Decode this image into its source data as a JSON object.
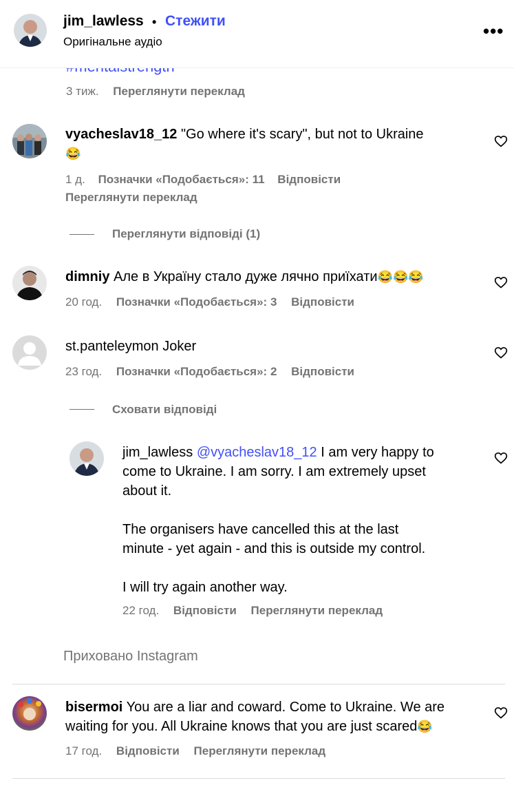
{
  "header": {
    "username": "jim_lawless",
    "separator": "•",
    "follow_label": "Стежити",
    "audio_label": "Оригінальне аудіо",
    "more_label": "•••"
  },
  "clipped_hashtag": "#mentalstrength",
  "caption_meta": {
    "time": "3 тиж.",
    "translate": "Переглянути переклад"
  },
  "comments": [
    {
      "username": "vyacheslav18_12",
      "text": "\"Go where it's scary\", but not to Ukraine",
      "emoji": "😂",
      "time": "1 д.",
      "likes": "Позначки «Подобається»: 11",
      "reply": "Відповісти",
      "translate": "Переглянути переклад",
      "replies_toggle": "Переглянути відповіді (1)"
    },
    {
      "username": "dimniy",
      "text": "Але в Україну стало дуже лячно приїхати",
      "emoji": "😂😂😂",
      "time": "20 год.",
      "likes": "Позначки «Подобається»: 3",
      "reply": "Відповісти"
    },
    {
      "username": "st.panteleymon",
      "text": "Joker",
      "time": "23 год.",
      "likes": "Позначки «Подобається»: 2",
      "reply": "Відповісти",
      "replies_toggle": "Сховати відповіді"
    }
  ],
  "reply": {
    "username": "jim_lawless",
    "mention": "@vyacheslav18_12",
    "line1": "I am very happy to",
    "line2": "come to Ukraine. I am sorry. I am extremely upset",
    "line3": "about it.",
    "line4": "The organisers have cancelled this at the last",
    "line5": "minute - yet again - and this is outside my control.",
    "line6": "I will try again another way.",
    "time": "22 год.",
    "reply_label": "Відповісти",
    "translate": "Переглянути переклад"
  },
  "hidden_label": "Приховано Instagram",
  "last_comment": {
    "username": "bisermoi",
    "line1": "You are a liar and coward. Come to Ukraine. We are",
    "line2": "waiting for you. All Ukraine knows that you are just scared",
    "emoji": "😂",
    "time": "17 год.",
    "reply": "Відповісти",
    "translate": "Переглянути переклад"
  },
  "colors": {
    "link": "#4150f7",
    "muted": "#737373",
    "divider": "#dbdbdb"
  }
}
